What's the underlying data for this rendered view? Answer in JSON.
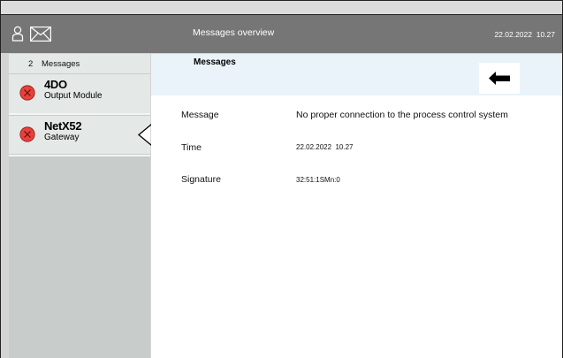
{
  "header": {
    "title": "Messages overview",
    "date": "22.02.2022",
    "time": "10.27",
    "icons": [
      "user-icon",
      "mail-icon"
    ]
  },
  "sidebar": {
    "count": "2",
    "count_label": "Messages",
    "devices": [
      {
        "name": "4DO",
        "subtitle": "Output Module",
        "status": "error",
        "icon": "error-icon"
      },
      {
        "name": "NetX52",
        "subtitle": "Gateway",
        "status": "error",
        "icon": "error-icon"
      }
    ]
  },
  "detail": {
    "heading": "Messages",
    "back_icon": "back-arrow-icon",
    "rows": [
      {
        "label": "Message",
        "value": "No proper connection to the process control system"
      },
      {
        "label": "Time",
        "value": "22.02.2022  10.27"
      },
      {
        "label": "Signature",
        "value": "32:51:1SMn:0"
      }
    ]
  },
  "colors": {
    "header_bg": "#767676",
    "sidebar_bg": "#c8cccb",
    "item_bg": "#e4e8e7",
    "message_bar_bg": "#e9f3f9",
    "error_red": "#e8413b"
  }
}
